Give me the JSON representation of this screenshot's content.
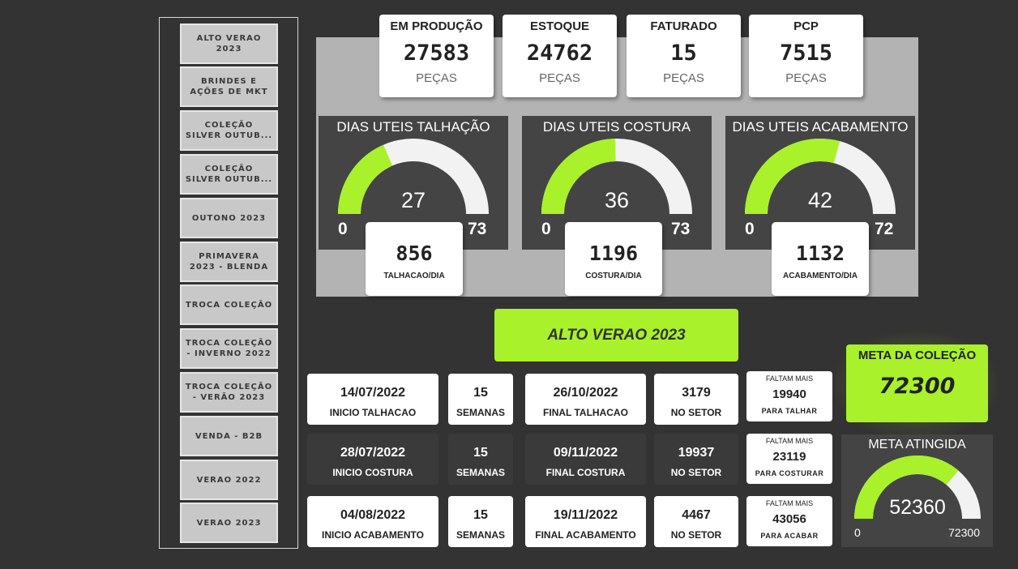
{
  "sidebar": {
    "items": [
      {
        "label": "ALTO VERAO\n2023",
        "selected": true
      },
      {
        "label": "BRINDES E\nAÇÕES DE MKT",
        "selected": false
      },
      {
        "label": "COLEÇÃO\nSILVER OUTUB...",
        "selected": false
      },
      {
        "label": "COLEÇÃO\nSILVER OUTUB...",
        "selected": false
      },
      {
        "label": "OUTONO 2023",
        "selected": false
      },
      {
        "label": "PRIMAVERA\n2023 - BLENDA",
        "selected": false
      },
      {
        "label": "TROCA COLEÇÃO",
        "selected": false
      },
      {
        "label": "TROCA COLEÇÃO\n- INVERNO 2022",
        "selected": false
      },
      {
        "label": "TROCA COLEÇÃO\n- VERÃO 2023",
        "selected": false
      },
      {
        "label": "VENDA - B2B",
        "selected": false
      },
      {
        "label": "VERAO 2022",
        "selected": false
      },
      {
        "label": "VERAO 2023",
        "selected": false
      }
    ]
  },
  "kpis": [
    {
      "title": "EM PRODUÇÃO",
      "value": "27583",
      "unit": "PEÇAS"
    },
    {
      "title": "ESTOQUE",
      "value": "24762",
      "unit": "PEÇAS"
    },
    {
      "title": "FATURADO",
      "value": "15",
      "unit": "PEÇAS"
    },
    {
      "title": "PCP",
      "value": "7515",
      "unit": "PEÇAS"
    }
  ],
  "gauges": [
    {
      "title": "DIAS UTEIS TALHAÇÃO",
      "value": 27,
      "min": 0,
      "max": 73,
      "rate_value": "856",
      "rate_label": "TALHACAO/DIA"
    },
    {
      "title": "DIAS UTEIS COSTURA",
      "value": 36,
      "min": 0,
      "max": 73,
      "rate_value": "1196",
      "rate_label": "COSTURA/DIA"
    },
    {
      "title": "DIAS UTEIS ACABAMENTO",
      "value": 42,
      "min": 0,
      "max": 72,
      "rate_value": "1132",
      "rate_label": "ACABAMENTO/DIA"
    }
  ],
  "banner": {
    "label": "ALTO VERAO 2023"
  },
  "rows": [
    {
      "start_date": "14/07/2022",
      "start_label": "INICIO TALHACAO",
      "weeks": "15",
      "weeks_label": "SEMANAS",
      "end_date": "26/10/2022",
      "end_label": "FINAL TALHACAO",
      "sector": "3179",
      "sector_label": "NO SETOR",
      "remain_head": "FALTAM MAIS",
      "remain_value": "19940",
      "remain_label": "PARA TALHAR"
    },
    {
      "start_date": "28/07/2022",
      "start_label": "INICIO COSTURA",
      "weeks": "15",
      "weeks_label": "SEMANAS",
      "end_date": "09/11/2022",
      "end_label": "FINAL COSTURA",
      "sector": "19937",
      "sector_label": "NO SETOR",
      "remain_head": "FALTAM MAIS",
      "remain_value": "23119",
      "remain_label": "PARA COSTURAR"
    },
    {
      "start_date": "04/08/2022",
      "start_label": "INICIO ACABAMENTO",
      "weeks": "15",
      "weeks_label": "SEMANAS",
      "end_date": "19/11/2022",
      "end_label": "FINAL ACABAMENTO",
      "sector": "4467",
      "sector_label": "NO SETOR",
      "remain_head": "FALTAM MAIS",
      "remain_value": "43056",
      "remain_label": "PARA ACABAR"
    }
  ],
  "meta": {
    "title": "META DA COLEÇÃO",
    "value": "72300"
  },
  "meta_atingida": {
    "title": "META ATINGIDA",
    "value": 52360,
    "min": 0,
    "max": 72300
  },
  "colors": {
    "accent": "#a9f12a",
    "gauge_track": "#f2f2f2",
    "card_dark": "#444444",
    "background": "#333333"
  }
}
